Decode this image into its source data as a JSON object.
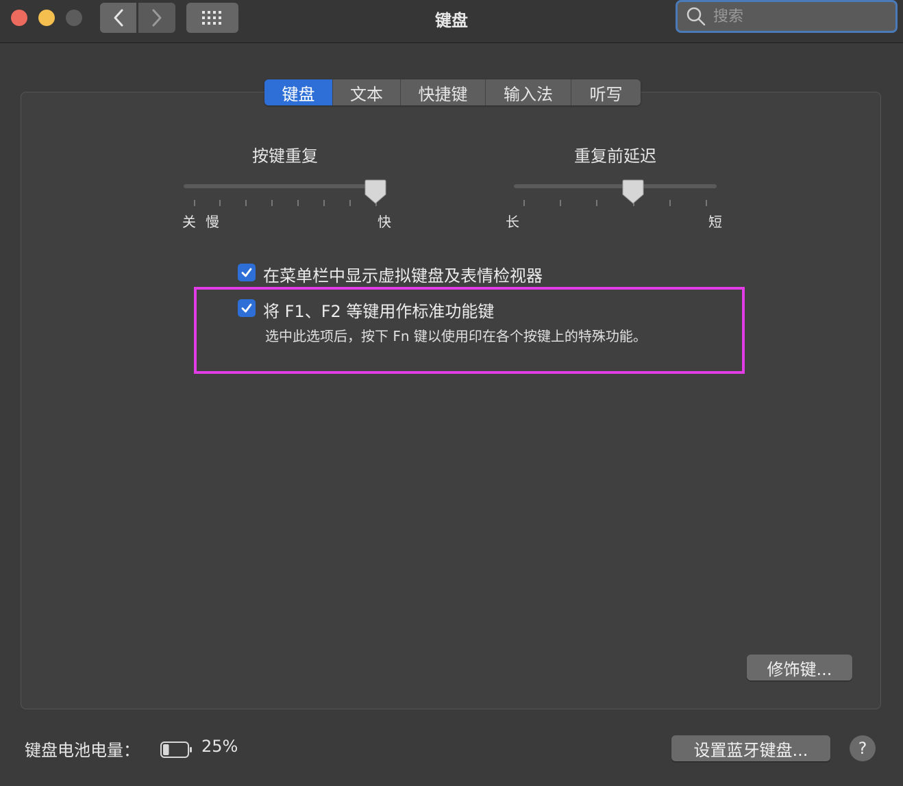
{
  "window": {
    "title": "键盘"
  },
  "toolbar": {
    "search_placeholder": "搜索"
  },
  "tabs": [
    {
      "label": "键盘",
      "active": true
    },
    {
      "label": "文本",
      "active": false
    },
    {
      "label": "快捷键",
      "active": false
    },
    {
      "label": "输入法",
      "active": false
    },
    {
      "label": "听写",
      "active": false
    }
  ],
  "key_repeat": {
    "title": "按键重复",
    "label_off": "关",
    "label_slow": "慢",
    "label_fast": "快",
    "value_fraction": 0.96
  },
  "repeat_delay": {
    "title": "重复前延迟",
    "label_long": "长",
    "label_short": "短",
    "value_fraction": 0.6
  },
  "options": {
    "show_viewer": {
      "label": "在菜单栏中显示虚拟键盘及表情检视器",
      "checked": true
    },
    "fn_keys": {
      "label": "将 F1、F2 等键用作标准功能键",
      "description": "选中此选项后，按下 Fn 键以使用印在各个按键上的特殊功能。",
      "checked": true
    }
  },
  "buttons": {
    "modifier_keys": "修饰键...",
    "bluetooth_keyboard": "设置蓝牙键盘...",
    "help": "?"
  },
  "battery": {
    "label": "键盘电池电量：",
    "percent": "25%",
    "level": 0.25
  },
  "colors": {
    "accent": "#2d6fd6",
    "highlight": "#e23ce6"
  }
}
